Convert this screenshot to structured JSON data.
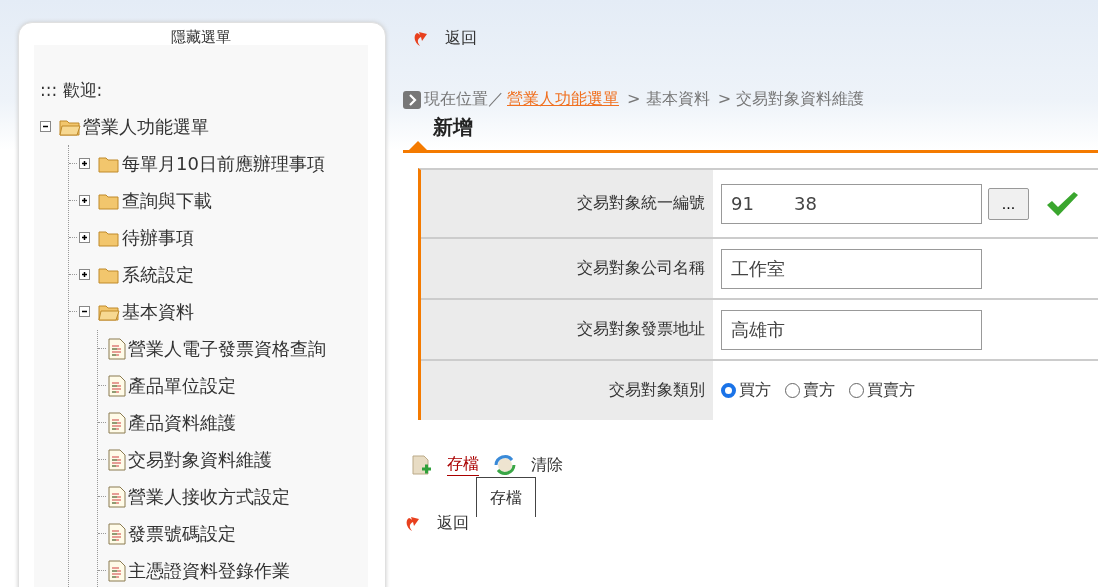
{
  "sidebar": {
    "title": "隱藏選單",
    "welcome": "::: 歡迎:",
    "tree": [
      {
        "label": "營業人功能選單",
        "kind": "folder",
        "expanded": true,
        "children": [
          {
            "label": "每單月10日前應辦理事項",
            "kind": "folder",
            "expanded": false
          },
          {
            "label": "查詢與下載",
            "kind": "folder",
            "expanded": false
          },
          {
            "label": "待辦事項",
            "kind": "folder",
            "expanded": false
          },
          {
            "label": "系統設定",
            "kind": "folder",
            "expanded": false
          },
          {
            "label": "基本資料",
            "kind": "folder",
            "expanded": true,
            "children": [
              {
                "label": "營業人電子發票資格查詢",
                "kind": "page"
              },
              {
                "label": "產品單位設定",
                "kind": "page"
              },
              {
                "label": "產品資料維護",
                "kind": "page"
              },
              {
                "label": "交易對象資料維護",
                "kind": "page"
              },
              {
                "label": "營業人接收方式設定",
                "kind": "page"
              },
              {
                "label": "發票號碼設定",
                "kind": "page"
              },
              {
                "label": "主憑證資料登錄作業",
                "kind": "page"
              }
            ]
          }
        ]
      }
    ]
  },
  "top_link": "返回",
  "breadcrumb": {
    "prefix": "現在位置／",
    "items": [
      {
        "label": "營業人功能選單",
        "kind": "link"
      },
      {
        "label": " > 基本資料",
        "kind": "text"
      },
      {
        "label": " > 交易對象資料維護",
        "kind": "text"
      }
    ]
  },
  "heading": "新增",
  "form": [
    {
      "label": "交易對象統一編號",
      "kind": "lookup",
      "value": "91       38",
      "button": "...",
      "verified": true
    },
    {
      "label": "交易對象公司名稱",
      "kind": "text",
      "value": "工作室"
    },
    {
      "label": "交易對象發票地址",
      "kind": "text",
      "value": "高雄市"
    },
    {
      "label": "交易對象類別",
      "kind": "radio",
      "options": [
        {
          "label": "買方",
          "selected": true
        },
        {
          "label": "賣方",
          "selected": false
        },
        {
          "label": "買賣方",
          "selected": false
        }
      ]
    }
  ],
  "actions": [
    {
      "label": "存檔",
      "kind": "save",
      "hovered": true
    },
    {
      "label": "清除",
      "kind": "clear",
      "hovered": false
    }
  ],
  "tooltip": "存檔",
  "bottom_link": "返回"
}
